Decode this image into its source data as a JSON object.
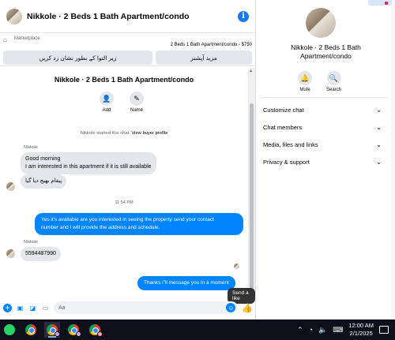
{
  "chat": {
    "header_title": "Nikkole · 2 Beds 1 Bath Apartment/condo",
    "marketplace_label": "Marketplace",
    "listing_price": "2 Beds 1 Bath Apartment/condo - $750",
    "btn_more_options": "مزید آپشنز",
    "btn_mark_pending": "زیر التوا کے بطور نشان زد کریں",
    "conversation_title": "Nikkole · 2 Beds 1 Bath Apartment/condo",
    "actions": [
      {
        "label": "Add",
        "icon": "add-person-icon"
      },
      {
        "label": "Name",
        "icon": "pencil-icon"
      }
    ],
    "system_text": "Nikkole started this chat.",
    "system_link": "View buyer profile",
    "sender_1": "Nikkole",
    "msg_in_1_line1": "Good morning",
    "msg_in_1_line2": "I am interested in this apartment if it is still available",
    "msg_in_2": "پیغام بھیج دیا گیا",
    "timestamp": "11:54 PM",
    "msg_out_1_line1": "Yes it's available are you interested in seeing the property send your contact",
    "msg_out_1_line2": "number and I will provide the address and schedule.",
    "sender_2": "Nikkole",
    "msg_in_3": "5594487990",
    "msg_out_2": "Thanks i\"ll message you in a moment",
    "composer_placeholder": "Aa",
    "tooltip": "Send a like"
  },
  "panel": {
    "title_line1": "Nikkole · 2 Beds 1 Bath",
    "title_line2": "Apartment/condo",
    "actions": [
      {
        "label": "Mute",
        "icon": "bell-icon"
      },
      {
        "label": "Search",
        "icon": "search-icon"
      }
    ],
    "sections": [
      "Customize chat",
      "Chat members",
      "Media, files and links",
      "Privacy & support"
    ]
  },
  "taskbar": {
    "time": "12:00 AM",
    "date": "2/1/2025"
  },
  "colors": {
    "accent": "#0084ff",
    "taskbar": "#0f0f1a"
  }
}
